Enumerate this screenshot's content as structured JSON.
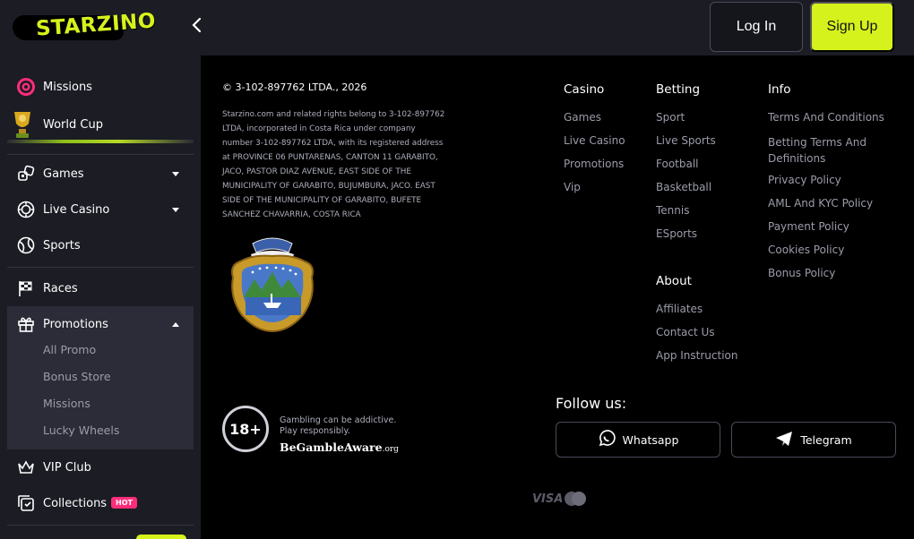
{
  "brand": {
    "name": "STARZINO"
  },
  "header": {
    "login_label": "Log In",
    "signup_label": "Sign Up"
  },
  "sidebar": {
    "top_items": [
      {
        "label": "Missions"
      },
      {
        "label": "World Cup"
      }
    ],
    "items": [
      {
        "label": "Games"
      },
      {
        "label": "Live Casino"
      },
      {
        "label": "Sports"
      },
      {
        "label": "Races"
      },
      {
        "label": "Promotions"
      },
      {
        "label": "VIP Club"
      },
      {
        "label": "Collections",
        "badge": "HOT"
      }
    ],
    "promotions_sub": [
      {
        "label": "All Promo"
      },
      {
        "label": "Bonus Store"
      },
      {
        "label": "Missions"
      },
      {
        "label": "Lucky Wheels"
      }
    ]
  },
  "footer": {
    "copyright": "© 3-102-897762 LTDA., 2026",
    "legal": "Starzino.com and related rights belong to 3-102-897762 LTDA, incorporated in Costa Rica under company number 3-102-897762 LTDA, with its registered address at PROVINCE 06 PUNTARENAS, CANTON 11 GARABITO, JACO, PASTOR DIAZ AVENUE, EAST SIDE OF THE MUNICIPALITY OF GARABITO, BUJUMBURA, JACO. EAST SIDE OF THE MUNICIPALITY OF GARABITO, BUFETE SANCHEZ CHAVARRIA, COSTA RICA",
    "casino": {
      "title": "Casino",
      "links": [
        "Games",
        "Live Casino",
        "Promotions",
        "Vip"
      ]
    },
    "betting": {
      "title": "Betting",
      "links": [
        "Sport",
        "Live Sports",
        "Football",
        "Basketball",
        "Tennis",
        "ESports"
      ]
    },
    "about": {
      "title": "About",
      "links": [
        "Affiliates",
        "Contact Us",
        "App Instruction"
      ]
    },
    "info": {
      "title": "Info",
      "links": [
        "Terms And Conditions",
        "Betting Terms And Definitions",
        "Privacy Policy",
        "AML And KYC Policy",
        "Payment Policy",
        "Cookies Policy",
        "Bonus Policy"
      ]
    },
    "follow_title": "Follow us:",
    "socials": [
      {
        "label": "Whatsapp"
      },
      {
        "label": "Telegram"
      }
    ],
    "age": "18+",
    "gamble_line1": "Gambling can be addictive.",
    "gamble_line2": "Play responsibly.",
    "begamble": "BeGambleAware",
    "begamble_org": "org",
    "visa": "VISA"
  },
  "colors": {
    "accent": "#d6f21c",
    "sidebar_bg": "#1b1c24",
    "hot_badge": "#ff2d7a"
  }
}
